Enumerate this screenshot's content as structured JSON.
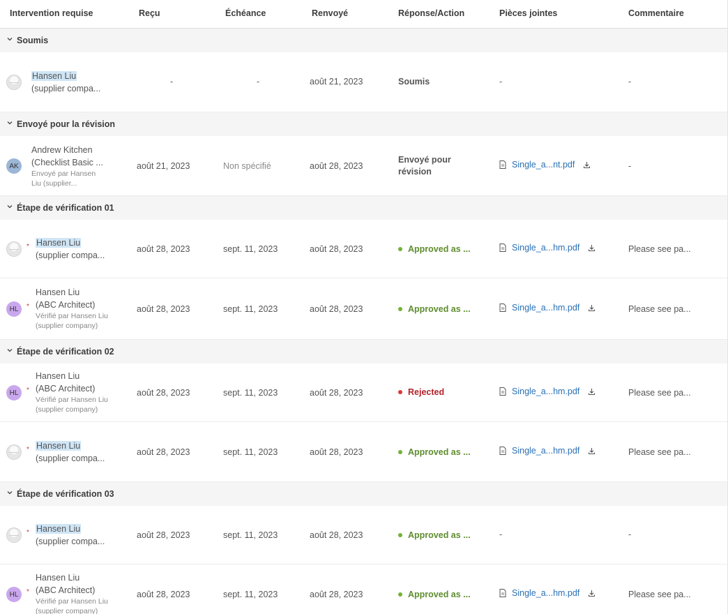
{
  "headers": {
    "intervention": "Intervention requise",
    "recu": "Reçu",
    "echeance": "Échéance",
    "renvoye": "Renvoyé",
    "reponse": "Réponse/Action",
    "pieces": "Pièces jointes",
    "commentaire": "Commentaire"
  },
  "groups": {
    "g1": {
      "title": "Soumis"
    },
    "g2": {
      "title": "Envoyé pour la révision"
    },
    "g3": {
      "title": "Étape de vérification 01"
    },
    "g4": {
      "title": "Étape de vérification 02"
    },
    "g5": {
      "title": "Étape de vérification 03"
    }
  },
  "rows": {
    "r1": {
      "name": "Hansen Liu",
      "company": "(supplier compa...",
      "recu": "-",
      "echeance": "-",
      "renvoye": "août 21, 2023",
      "status": "Soumis",
      "attachment": "-",
      "comment": "-"
    },
    "r2": {
      "initials": "AK",
      "name": "Andrew Kitchen",
      "company": "(Checklist Basic ...",
      "sub1": "Envoyé par Hansen",
      "sub2": "Liu (supplier...",
      "recu": "août 21, 2023",
      "echeance": "Non spécifié",
      "renvoye": "août 28, 2023",
      "status1": "Envoyé pour",
      "status2": "révision",
      "attachment": "Single_a...nt.pdf",
      "comment": "-"
    },
    "r3": {
      "name": "Hansen Liu",
      "company": "(supplier compa...",
      "recu": "août 28, 2023",
      "echeance": "sept. 11, 2023",
      "renvoye": "août 28, 2023",
      "status": "Approved as ...",
      "attachment": "Single_a...hm.pdf",
      "comment": "Please see pa..."
    },
    "r4": {
      "initials": "HL",
      "name": "Hansen Liu",
      "company": "(ABC Architect)",
      "sub1": "Vérifié par Hansen Liu",
      "sub2": "(supplier company)",
      "recu": "août 28, 2023",
      "echeance": "sept. 11, 2023",
      "renvoye": "août 28, 2023",
      "status": "Approved as ...",
      "attachment": "Single_a...hm.pdf",
      "comment": "Please see pa..."
    },
    "r5": {
      "initials": "HL",
      "name": "Hansen Liu",
      "company": "(ABC Architect)",
      "sub1": "Vérifié par Hansen Liu",
      "sub2": "(supplier company)",
      "recu": "août 28, 2023",
      "echeance": "sept. 11, 2023",
      "renvoye": "août 28, 2023",
      "status": "Rejected",
      "attachment": "Single_a...hm.pdf",
      "comment": "Please see pa..."
    },
    "r6": {
      "name": "Hansen Liu",
      "company": "(supplier compa...",
      "recu": "août 28, 2023",
      "echeance": "sept. 11, 2023",
      "renvoye": "août 28, 2023",
      "status": "Approved as ...",
      "attachment": "Single_a...hm.pdf",
      "comment": "Please see pa..."
    },
    "r7": {
      "name": "Hansen Liu",
      "company": "(supplier compa...",
      "recu": "août 28, 2023",
      "echeance": "sept. 11, 2023",
      "renvoye": "août 28, 2023",
      "status": "Approved as ...",
      "attachment": "-",
      "comment": "-"
    },
    "r8": {
      "initials": "HL",
      "name": "Hansen Liu",
      "company": "(ABC Architect)",
      "sub1": "Vérifié par Hansen Liu",
      "sub2": "(supplier company)",
      "recu": "août 28, 2023",
      "echeance": "sept. 11, 2023",
      "renvoye": "août 28, 2023",
      "status": "Approved as ...",
      "attachment": "Single_a...hm.pdf",
      "comment": "Please see pa..."
    }
  },
  "colors": {
    "approved": "#5e8c2e",
    "rejected": "#b4212b",
    "link": "#2a70b3",
    "group_bg": "#f5f5f5",
    "highlight": "#cfe5f5"
  }
}
